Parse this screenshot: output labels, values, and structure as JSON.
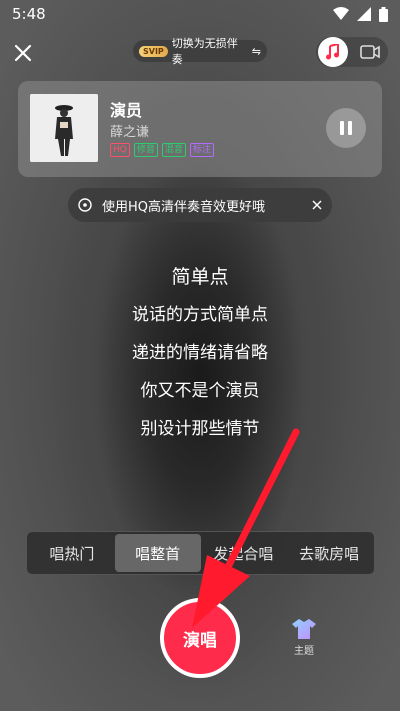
{
  "status_bar": {
    "time": "5:48"
  },
  "top_bar": {
    "svip_badge": "SVIP",
    "switch_text": "切换为无损伴奏",
    "switch_icon": "⇋"
  },
  "song": {
    "title": "演员",
    "artist": "薛之谦",
    "tags": [
      {
        "label": "HQ",
        "color": "#ff4d6a"
      },
      {
        "label": "修音",
        "color": "#2ecc71"
      },
      {
        "label": "混音",
        "color": "#2ecc71"
      },
      {
        "label": "标注",
        "color": "#b36bff"
      }
    ]
  },
  "hq_tip": {
    "text": "使用HQ高清伴奏音效更好哦"
  },
  "lyrics": [
    "简单点",
    "说话的方式简单点",
    "递进的情绪请省略",
    "你又不是个演员",
    "别设计那些情节"
  ],
  "mode_tabs": [
    "唱热门",
    "唱整首",
    "发起合唱",
    "去歌房唱"
  ],
  "active_tab": 1,
  "sing_button": {
    "label": "演唱",
    "color": "#ff2b4a"
  },
  "theme_button": {
    "label": "主题"
  },
  "accent_color": "#ff2b4a",
  "arrow_color": "#ff1a2e"
}
